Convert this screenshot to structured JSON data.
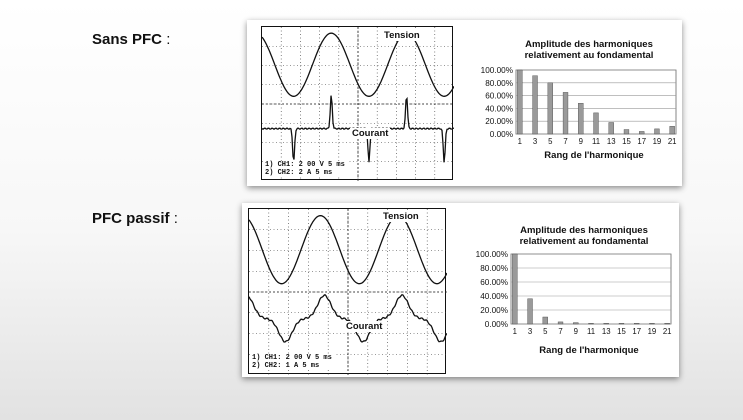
{
  "sections": [
    {
      "heading": "Sans PFC",
      "heading_suffix": " :",
      "scope": {
        "tension_label": "Tension",
        "courant_label": "Courant",
        "legend_ch1": "1) CH1:   2 00 V  5 ms",
        "legend_ch2": "2) CH2:   2 A  5 ms"
      },
      "chart_data": {
        "type": "bar",
        "title_line1": "Amplitude des harmoniques",
        "title_line2": "relativement au fondamental",
        "xlabel": "Rang de l'harmonique",
        "ylim": [
          0,
          100
        ],
        "y_ticks": [
          "100.00%",
          "80.00%",
          "60.00%",
          "40.00%",
          "20.00%",
          "0.00%"
        ],
        "x_ticks": [
          "1",
          "3",
          "5",
          "7",
          "9",
          "11",
          "13",
          "15",
          "17",
          "19",
          "21"
        ],
        "categories": [
          "1",
          "2",
          "3",
          "4",
          "5",
          "6",
          "7",
          "8",
          "9",
          "10",
          "11",
          "12",
          "13",
          "14",
          "15",
          "16",
          "17",
          "18",
          "19",
          "20",
          "21"
        ],
        "values": [
          100,
          0,
          91,
          0,
          80,
          0,
          65,
          0,
          48,
          0,
          33,
          0,
          18,
          0,
          7,
          0,
          4,
          0,
          8,
          0,
          12
        ],
        "bar_color": "#9a9a9a"
      }
    },
    {
      "heading": "PFC passif",
      "heading_suffix": " :",
      "scope": {
        "tension_label": "Tension",
        "courant_label": "Courant",
        "legend_ch1": "1) CH1:   2 00 V  5 ms",
        "legend_ch2": "2) CH2:   1 A  5 ms"
      },
      "chart_data": {
        "type": "bar",
        "title_line1": "Amplitude des harmoniques",
        "title_line2": "relativement au fondamental",
        "xlabel": "Rang de l'harmonique",
        "ylim": [
          0,
          100
        ],
        "y_ticks": [
          "100.00%",
          "80.00%",
          "60.00%",
          "40.00%",
          "20.00%",
          "0.00%"
        ],
        "x_ticks": [
          "1",
          "3",
          "5",
          "7",
          "9",
          "11",
          "13",
          "15",
          "17",
          "19",
          "21"
        ],
        "categories": [
          "1",
          "2",
          "3",
          "4",
          "5",
          "6",
          "7",
          "8",
          "9",
          "10",
          "11",
          "12",
          "13",
          "14",
          "15",
          "16",
          "17",
          "18",
          "19",
          "20",
          "21"
        ],
        "values": [
          100,
          0,
          36,
          0,
          10,
          0,
          3,
          0,
          2,
          0,
          1,
          0,
          1,
          0,
          1,
          0,
          1,
          0,
          1,
          0,
          1
        ],
        "bar_color": "#9a9a9a"
      }
    }
  ]
}
